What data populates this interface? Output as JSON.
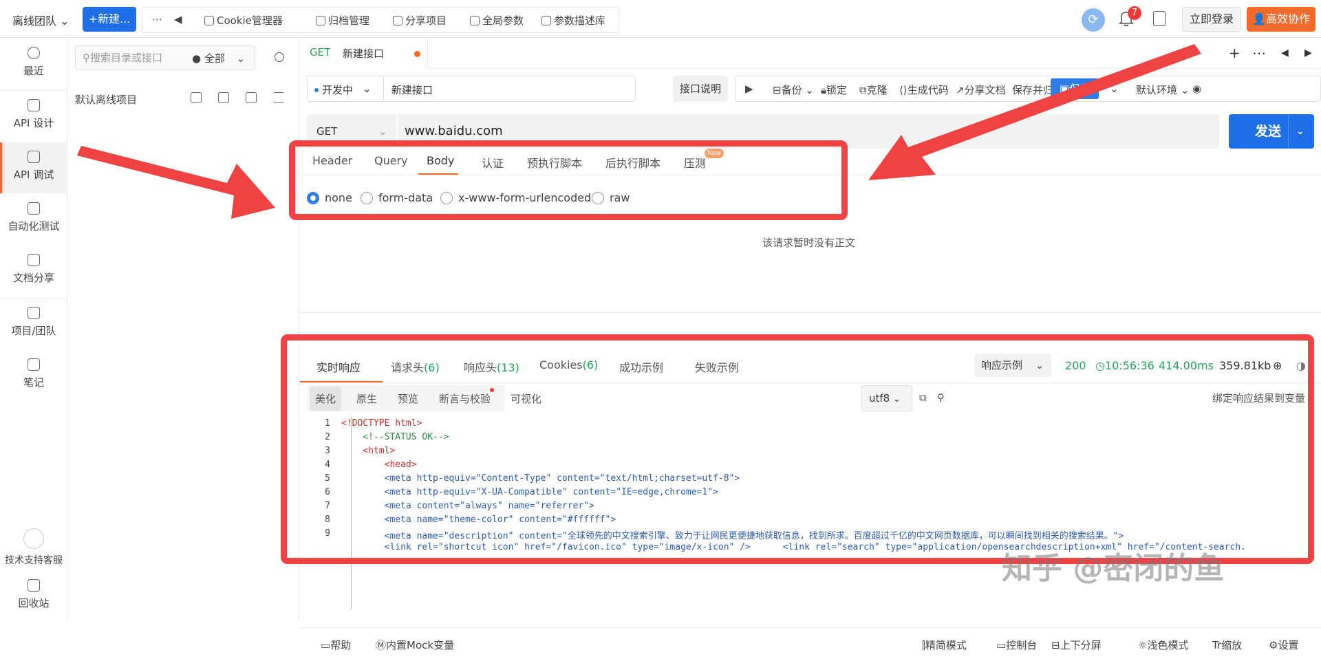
{
  "topbar": {
    "team": "离线团队",
    "new_button": "+新建...",
    "tools": [
      "Cookie管理器",
      "归档管理",
      "分享项目",
      "全局参数",
      "参数描述库"
    ],
    "notification_count": "7",
    "login": "立即登录",
    "collab": "高效协作"
  },
  "leftnav": {
    "items": [
      "最近",
      "API 设计",
      "API 调试",
      "自动化测试",
      "文档分享",
      "项目/团队",
      "笔记"
    ],
    "support": "技术支持客服",
    "recycle": "回收站"
  },
  "tree": {
    "search_placeholder": "搜索目录或接口",
    "filter": "全部",
    "project": "默认离线项目"
  },
  "request_tab": {
    "method": "GET",
    "name": "新建接口"
  },
  "request": {
    "status": "开发中",
    "name": "新建接口",
    "desc_button": "接口说明",
    "actions": [
      "备份",
      "锁定",
      "克隆",
      "生成代码",
      "分享文档",
      "保存并归档"
    ],
    "save": "保存",
    "env": "默认环境",
    "method": "GET",
    "url": "www.baidu.com",
    "send": "发送"
  },
  "param_tabs": [
    "Header",
    "Query",
    "Body",
    "认证",
    "预执行脚本",
    "后执行脚本",
    "压测"
  ],
  "new_tag": "New",
  "body_types": [
    "none",
    "form-data",
    "x-www-form-urlencoded",
    "raw"
  ],
  "body_selected": "none",
  "empty_body": "该请求暂时没有正文",
  "response": {
    "tabs": [
      {
        "label": "实时响应",
        "count": ""
      },
      {
        "label": "请求头",
        "count": "(6)"
      },
      {
        "label": "响应头",
        "count": "(13)"
      },
      {
        "label": "Cookies",
        "count": "(6)"
      },
      {
        "label": "成功示例",
        "count": ""
      },
      {
        "label": "失败示例",
        "count": ""
      }
    ],
    "sample": "响应示例",
    "status_code": "200",
    "time": "10:56:36",
    "duration": "414.00ms",
    "size": "359.81kb",
    "formats": [
      "美化",
      "原生",
      "预览",
      "断言与校验",
      "可视化"
    ],
    "encoding": "utf8",
    "bind": "绑定响应结果到变量"
  },
  "code_lines": [
    "<!DOCTYPE html>",
    "    <!--STATUS OK-->",
    "    <html>",
    "        <head>",
    "        <meta http-equiv=\"Content-Type\" content=\"text/html;charset=utf-8\">",
    "        <meta http-equiv=\"X-UA-Compatible\" content=\"IE=edge,chrome=1\">",
    "        <meta content=\"always\" name=\"referrer\">",
    "        <meta name=\"theme-color\" content=\"#ffffff\">",
    "        <meta name=\"description\" content=\"全球领先的中文搜索引擎、致力于让网民更便捷地获取信息，找到所求。百度超过千亿的中文网页数据库，可以瞬间找到相关的搜索结果。\">",
    "        <link rel=\"shortcut icon\" href=\"/favicon.ico\" type=\"image/x-icon\" />      <link rel=\"search\" type=\"application/opensearchdescription+xml\" href=\"/content-search."
  ],
  "bottombar": {
    "left": [
      "帮助",
      "内置Mock变量"
    ],
    "right": [
      "精简模式",
      "控制台",
      "上下分屏",
      "浅色模式",
      "缩放",
      "设置"
    ]
  },
  "watermark": "知乎 @密闭的鱼",
  "colors": {
    "accent": "#f36b2a",
    "primary": "#1e6fe6",
    "annotation": "#ef4343",
    "success": "#22a35a"
  }
}
